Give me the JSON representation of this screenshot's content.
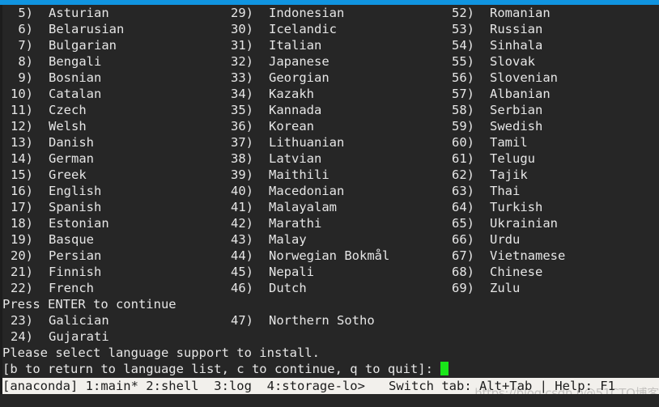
{
  "window": {
    "accent_color": "#1094e0",
    "background_color": "#262626",
    "text_color": "#e6e6e6",
    "cursor_color": "#19e619",
    "statusbar_background": "#f2f0ec",
    "statusbar_text_color": "#1c1c1c"
  },
  "language_list": {
    "column1": [
      {
        "num": "5)",
        "label": "Asturian"
      },
      {
        "num": "6)",
        "label": "Belarusian"
      },
      {
        "num": "7)",
        "label": "Bulgarian"
      },
      {
        "num": "8)",
        "label": "Bengali"
      },
      {
        "num": "9)",
        "label": "Bosnian"
      },
      {
        "num": "10)",
        "label": "Catalan"
      },
      {
        "num": "11)",
        "label": "Czech"
      },
      {
        "num": "12)",
        "label": "Welsh"
      },
      {
        "num": "13)",
        "label": "Danish"
      },
      {
        "num": "14)",
        "label": "German"
      },
      {
        "num": "15)",
        "label": "Greek"
      },
      {
        "num": "16)",
        "label": "English"
      },
      {
        "num": "17)",
        "label": "Spanish"
      },
      {
        "num": "18)",
        "label": "Estonian"
      },
      {
        "num": "19)",
        "label": "Basque"
      },
      {
        "num": "20)",
        "label": "Persian"
      },
      {
        "num": "21)",
        "label": "Finnish"
      },
      {
        "num": "22)",
        "label": "French"
      }
    ],
    "column1_after_break": [
      {
        "num": "23)",
        "label": "Galician"
      },
      {
        "num": "24)",
        "label": "Gujarati"
      }
    ],
    "column2": [
      {
        "num": "29)",
        "label": "Indonesian"
      },
      {
        "num": "30)",
        "label": "Icelandic"
      },
      {
        "num": "31)",
        "label": "Italian"
      },
      {
        "num": "32)",
        "label": "Japanese"
      },
      {
        "num": "33)",
        "label": "Georgian"
      },
      {
        "num": "34)",
        "label": "Kazakh"
      },
      {
        "num": "35)",
        "label": "Kannada"
      },
      {
        "num": "36)",
        "label": "Korean"
      },
      {
        "num": "37)",
        "label": "Lithuanian"
      },
      {
        "num": "38)",
        "label": "Latvian"
      },
      {
        "num": "39)",
        "label": "Maithili"
      },
      {
        "num": "40)",
        "label": "Macedonian"
      },
      {
        "num": "41)",
        "label": "Malayalam"
      },
      {
        "num": "42)",
        "label": "Marathi"
      },
      {
        "num": "43)",
        "label": "Malay"
      },
      {
        "num": "44)",
        "label": "Norwegian Bokmål"
      },
      {
        "num": "45)",
        "label": "Nepali"
      },
      {
        "num": "46)",
        "label": "Dutch"
      }
    ],
    "column2_after_break": [
      {
        "num": "47)",
        "label": "Northern Sotho"
      }
    ],
    "column3": [
      {
        "num": "52)",
        "label": "Romanian"
      },
      {
        "num": "53)",
        "label": "Russian"
      },
      {
        "num": "54)",
        "label": "Sinhala"
      },
      {
        "num": "55)",
        "label": "Slovak"
      },
      {
        "num": "56)",
        "label": "Slovenian"
      },
      {
        "num": "57)",
        "label": "Albanian"
      },
      {
        "num": "58)",
        "label": "Serbian"
      },
      {
        "num": "59)",
        "label": "Swedish"
      },
      {
        "num": "60)",
        "label": "Tamil"
      },
      {
        "num": "61)",
        "label": "Telugu"
      },
      {
        "num": "62)",
        "label": "Tajik"
      },
      {
        "num": "63)",
        "label": "Thai"
      },
      {
        "num": "64)",
        "label": "Turkish"
      },
      {
        "num": "65)",
        "label": "Ukrainian"
      },
      {
        "num": "66)",
        "label": "Urdu"
      },
      {
        "num": "67)",
        "label": "Vietnamese"
      },
      {
        "num": "68)",
        "label": "Chinese"
      },
      {
        "num": "69)",
        "label": "Zulu"
      }
    ]
  },
  "messages": {
    "press_enter": "Press ENTER to continue",
    "instruction": "Please select language support to install.",
    "prompt": "[b to return to language list, c to continue, q to quit]:"
  },
  "statusbar": {
    "left": "[anaconda] 1:main* 2:shell  3:log  4:storage-lo>",
    "right": "Switch tab: Alt+Tab | Help: F1"
  },
  "watermark": {
    "text": "https://blog.csdn.n@51CTO博客"
  }
}
